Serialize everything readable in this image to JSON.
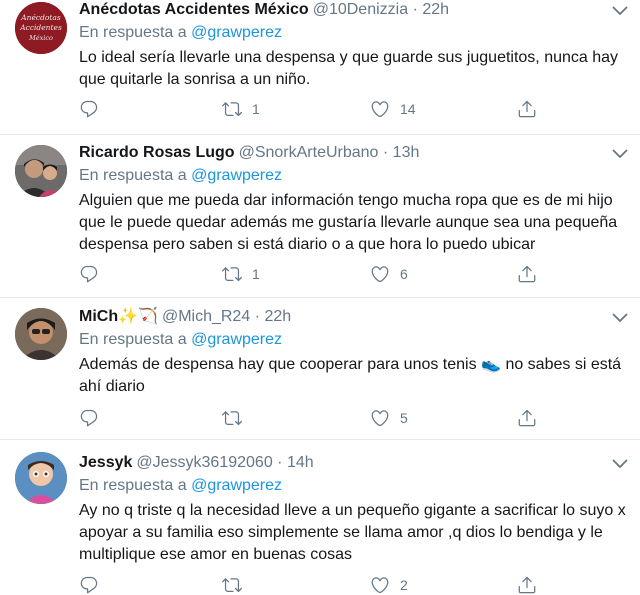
{
  "tweets": [
    {
      "name": "Anécdotas Accidentes México",
      "handle": "@10Denizzia",
      "time": "22h",
      "reply_prefix": "En respuesta a",
      "reply_to": "@grawperez",
      "text": "Lo ideal sería llevarle una despensa y que guarde sus juguetitos, nunca hay que quitarle la sonrisa a un niño.",
      "avatar_text": "Anécdotas Accidentes México",
      "replies": "",
      "retweets": "1",
      "likes": "14"
    },
    {
      "name": "Ricardo Rosas Lugo",
      "handle": "@SnorkArteUrbano",
      "time": "13h",
      "reply_prefix": "En respuesta a",
      "reply_to": "@grawperez",
      "text": "Alguien que me pueda dar información tengo mucha ropa que es de mi hijo que le puede quedar además me gustaría llevarle aunque sea una pequeña despensa pero saben si está diario o a que hora lo puedo ubicar",
      "replies": "",
      "retweets": "1",
      "likes": "6"
    },
    {
      "name": "MiCh",
      "name_emoji_1": "✨",
      "name_emoji_2": "🏹",
      "handle": "@Mich_R24",
      "time": "22h",
      "reply_prefix": "En respuesta a",
      "reply_to": "@grawperez",
      "text_part1": "Además de despensa hay que cooperar para unos tenis",
      "text_emoji": "👟",
      "text_part2": "no sabes si está ahí diario",
      "replies": "",
      "retweets": "",
      "likes": "5"
    },
    {
      "name": "Jessyk",
      "handle": "@Jessyk36192060",
      "time": "14h",
      "reply_prefix": "En respuesta a",
      "reply_to": "@grawperez",
      "text": "Ay no q triste q la necesidad lleve a un pequeño gigante a sacrificar lo suyo x apoyar a su familia eso simplemente se llama amor ,q dios lo bendiga y le multiplique ese amor en buenas cosas",
      "replies": "",
      "retweets": "",
      "likes": "2"
    }
  ],
  "separator": "·",
  "icons": {
    "reply": "reply-icon",
    "retweet": "retweet-icon",
    "like": "heart-icon",
    "share": "share-icon",
    "menu": "chevron-down-icon"
  },
  "colors": {
    "text": "#14171a",
    "muted": "#657786",
    "link": "#1b95e0",
    "border": "#e6ecf0"
  }
}
